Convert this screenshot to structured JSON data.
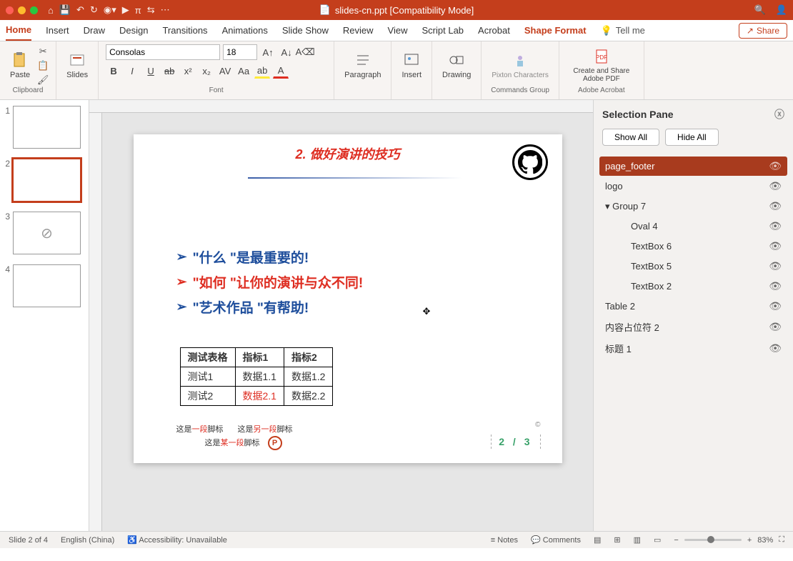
{
  "window": {
    "title": "slides-cn.ppt [Compatibility Mode]"
  },
  "tabs": {
    "home": "Home",
    "insert": "Insert",
    "draw": "Draw",
    "design": "Design",
    "transitions": "Transitions",
    "animations": "Animations",
    "slideshow": "Slide Show",
    "review": "Review",
    "view": "View",
    "scriptlab": "Script Lab",
    "acrobat": "Acrobat",
    "shapeformat": "Shape Format",
    "tellme": "Tell me",
    "share": "Share"
  },
  "ribbon": {
    "clipboard": {
      "label": "Clipboard",
      "paste": "Paste"
    },
    "slides": {
      "label": "Slides",
      "btn": "Slides"
    },
    "font": {
      "label": "Font",
      "name": "Consolas",
      "size": "18"
    },
    "paragraph": {
      "label": "Paragraph",
      "btn": "Paragraph"
    },
    "insert": {
      "btn": "Insert"
    },
    "drawing": {
      "btn": "Drawing"
    },
    "commands": {
      "label": "Commands Group",
      "pixton": "Pixton Characters"
    },
    "acrobat": {
      "label": "Adobe Acrobat",
      "btn": "Create and Share Adobe PDF"
    }
  },
  "thumbs": {
    "1": "1",
    "2": "2",
    "3": "3",
    "4": "4"
  },
  "slide": {
    "title": "2. 做好演讲的技巧",
    "b1": "\"什么 \"是最重要的!",
    "b2": "\"如何 \"让你的演讲与众不同!",
    "b3": "\"艺术作品 \"有帮助!",
    "table": {
      "h1": "测试表格",
      "h2": "指标1",
      "h3": "指标2",
      "r1c1": "测试1",
      "r1c2": "数据1.1",
      "r1c3": "数据1.2",
      "r2c1": "测试2",
      "r2c2": "数据2.1",
      "r2c3": "数据2.2"
    },
    "footer1a": "这是",
    "footer1b": "一段",
    "footer1c": "脚标",
    "footer2a": "这是",
    "footer2b": "另一段",
    "footer2c": "脚标",
    "footer3a": "这是",
    "footer3b": "某一段",
    "footer3c": "脚标",
    "pagenum": "2 / 3"
  },
  "selpane": {
    "title": "Selection Pane",
    "showall": "Show All",
    "hideall": "Hide All",
    "items": {
      "page_footer": "page_footer",
      "logo": "logo",
      "group7": "Group 7",
      "oval4": "Oval 4",
      "tb6": "TextBox 6",
      "tb5": "TextBox 5",
      "tb2": "TextBox 2",
      "table2": "Table 2",
      "content": "内容占位符 2",
      "title1": "标题 1"
    }
  },
  "status": {
    "slide": "Slide 2 of 4",
    "lang": "English (China)",
    "access": "Accessibility: Unavailable",
    "notes": "Notes",
    "comments": "Comments",
    "zoom": "83%"
  }
}
